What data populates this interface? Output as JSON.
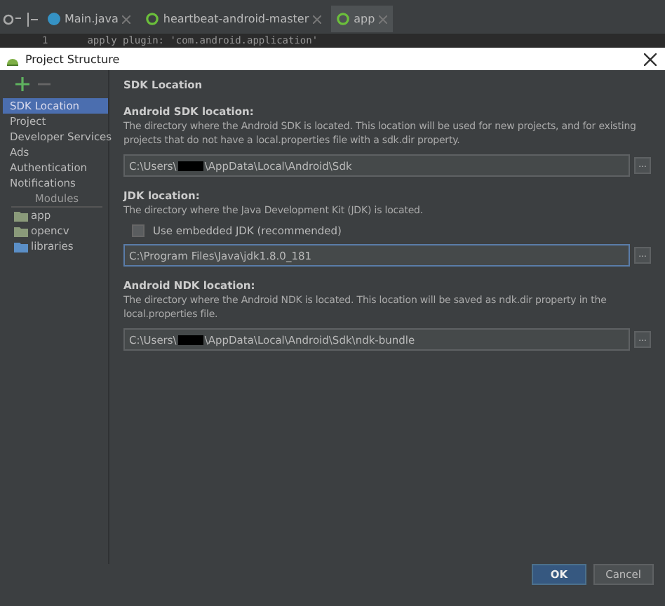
{
  "editor_tabs": [
    {
      "label": "Main.java",
      "kind": "java",
      "selected": false
    },
    {
      "label": "heartbeat-android-master",
      "kind": "gradle",
      "selected": false
    },
    {
      "label": "app",
      "kind": "gradle",
      "selected": true
    }
  ],
  "line_number": "1",
  "editor_line": "apply plugin: 'com.android.application'",
  "dialog": {
    "title": "Project Structure",
    "sidebar": {
      "items": [
        {
          "label": "SDK Location",
          "selected": true
        },
        {
          "label": "Project",
          "selected": false
        },
        {
          "label": "Developer Services",
          "selected": false
        },
        {
          "label": "Ads",
          "selected": false
        },
        {
          "label": "Authentication",
          "selected": false
        },
        {
          "label": "Notifications",
          "selected": false
        }
      ],
      "modules_header": "Modules",
      "modules": [
        {
          "label": "app",
          "selected": false
        },
        {
          "label": "opencv",
          "selected": false
        },
        {
          "label": "libraries",
          "selected": false
        }
      ]
    },
    "heading": "SDK Location",
    "sections": [
      {
        "label": "Android SDK location:",
        "description": "The directory where the Android SDK is located. This location will be used for new projects, and for existing projects that do not have a local.properties file with a sdk.dir property.",
        "path": [
          "C:\\Users\\",
          "\\AppData\\Local\\Android\\Sdk"
        ],
        "focused": false,
        "button": "..."
      },
      {
        "label": "JDK location:",
        "description": "The directory where the Java Development Kit (JDK) is located.",
        "checkbox": {
          "label": "Use embedded JDK (recommended)",
          "checked": false
        },
        "path": [
          "C:\\Program Files\\Java\\jdk1.8.0_181"
        ],
        "focused": true,
        "button": "..."
      },
      {
        "label": "Android NDK location:",
        "description": "The directory where the Android NDK is located. This location will be saved as ndk.dir property in the local.properties file.",
        "path": [
          "C:\\Users\\",
          "\\AppData\\Local\\Android\\Sdk\\ndk-bundle"
        ],
        "focused": false,
        "button": "..."
      }
    ],
    "buttons": [
      {
        "label": "OK",
        "kind": "primary"
      },
      {
        "label": "Cancel",
        "kind": "secondary"
      }
    ]
  }
}
